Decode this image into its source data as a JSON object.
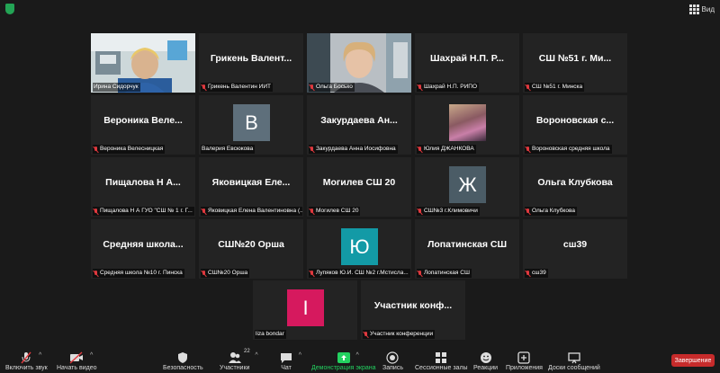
{
  "top": {
    "view_label": "Вид"
  },
  "tiles": [
    {
      "big": "",
      "label": "Ирина Сидорчук",
      "muted": false
    },
    {
      "big": "Грикень Валент...",
      "label": "Грикень Валентин ИИТ",
      "muted": true
    },
    {
      "big": "",
      "label": "Ольга Босько",
      "muted": true
    },
    {
      "big": "Шахрай Н.П. Р...",
      "label": "Шахрай Н.П. РИПО",
      "muted": true
    },
    {
      "big": "СШ №51 г. Ми...",
      "label": "СШ №51 г. Минска",
      "muted": true
    },
    {
      "big": "Вероника Веле...",
      "label": "Вероника Велесницкая",
      "muted": true
    },
    {
      "big": "",
      "label": "Валерия Евсюкова",
      "avatar": "В",
      "avatar_color": "#5e6f7b",
      "muted": false
    },
    {
      "big": "Закурдаева Ан...",
      "label": "Закурдаева Анна Иосифовна",
      "muted": true
    },
    {
      "big": "",
      "label": "Юлия ДЖАНКОВА",
      "muted": true
    },
    {
      "big": "Вороновская с...",
      "label": "Вороновская средняя школа",
      "muted": true
    },
    {
      "big": "Пищалова Н А...",
      "label": "Пищалова Н А ГУО \"СШ № 1 г. Г...",
      "muted": true
    },
    {
      "big": "Яковицкая Еле...",
      "label": "Яковицкая Елена Валентиновна (...",
      "muted": true
    },
    {
      "big": "Могилев СШ 20",
      "label": "Могилев СШ 20",
      "muted": true
    },
    {
      "big": "",
      "label": "СШ№3 г.Климовичи",
      "avatar": "Ж",
      "avatar_color": "#4b5c66",
      "muted": true
    },
    {
      "big": "Ольга Клубкова",
      "label": "Ольга Клубкова",
      "muted": true
    },
    {
      "big": "Средняя школа...",
      "label": "Средняя школа №10 г. Пинска",
      "muted": true
    },
    {
      "big": "СШ№20 Орша",
      "label": "СШ№20 Орша",
      "muted": true
    },
    {
      "big": "",
      "label": "Лупяков Ю.И. СШ №2 г.Мстисла...",
      "avatar": "Ю",
      "avatar_color": "#139aa6",
      "muted": true
    },
    {
      "big": "Лопатинская СШ",
      "label": "Лопатинская СШ",
      "muted": true
    },
    {
      "big": "сш39",
      "label": "сш39",
      "muted": true
    },
    {
      "big": "",
      "label": "liza bondar",
      "avatar": "I",
      "avatar_color": "#d6195e",
      "muted": false
    },
    {
      "big": "Участник конф...",
      "label": "Участник конференции",
      "muted": true
    }
  ],
  "toolbar": {
    "unmute": "Включить звук",
    "start_video": "Начать видео",
    "security": "Безопасность",
    "participants": "Участники",
    "participants_count": "22",
    "chat": "Чат",
    "share": "Демонстрация экрана",
    "record": "Запись",
    "breakout": "Сессионные залы",
    "reactions": "Реакции",
    "apps": "Приложения",
    "whiteboards": "Доски сообщений",
    "end": "Завершение"
  },
  "colors": {
    "accent_green": "#23d160",
    "active_border": "#7fd63a",
    "end_red": "#c72b2b",
    "muted_red": "#e0393e"
  }
}
